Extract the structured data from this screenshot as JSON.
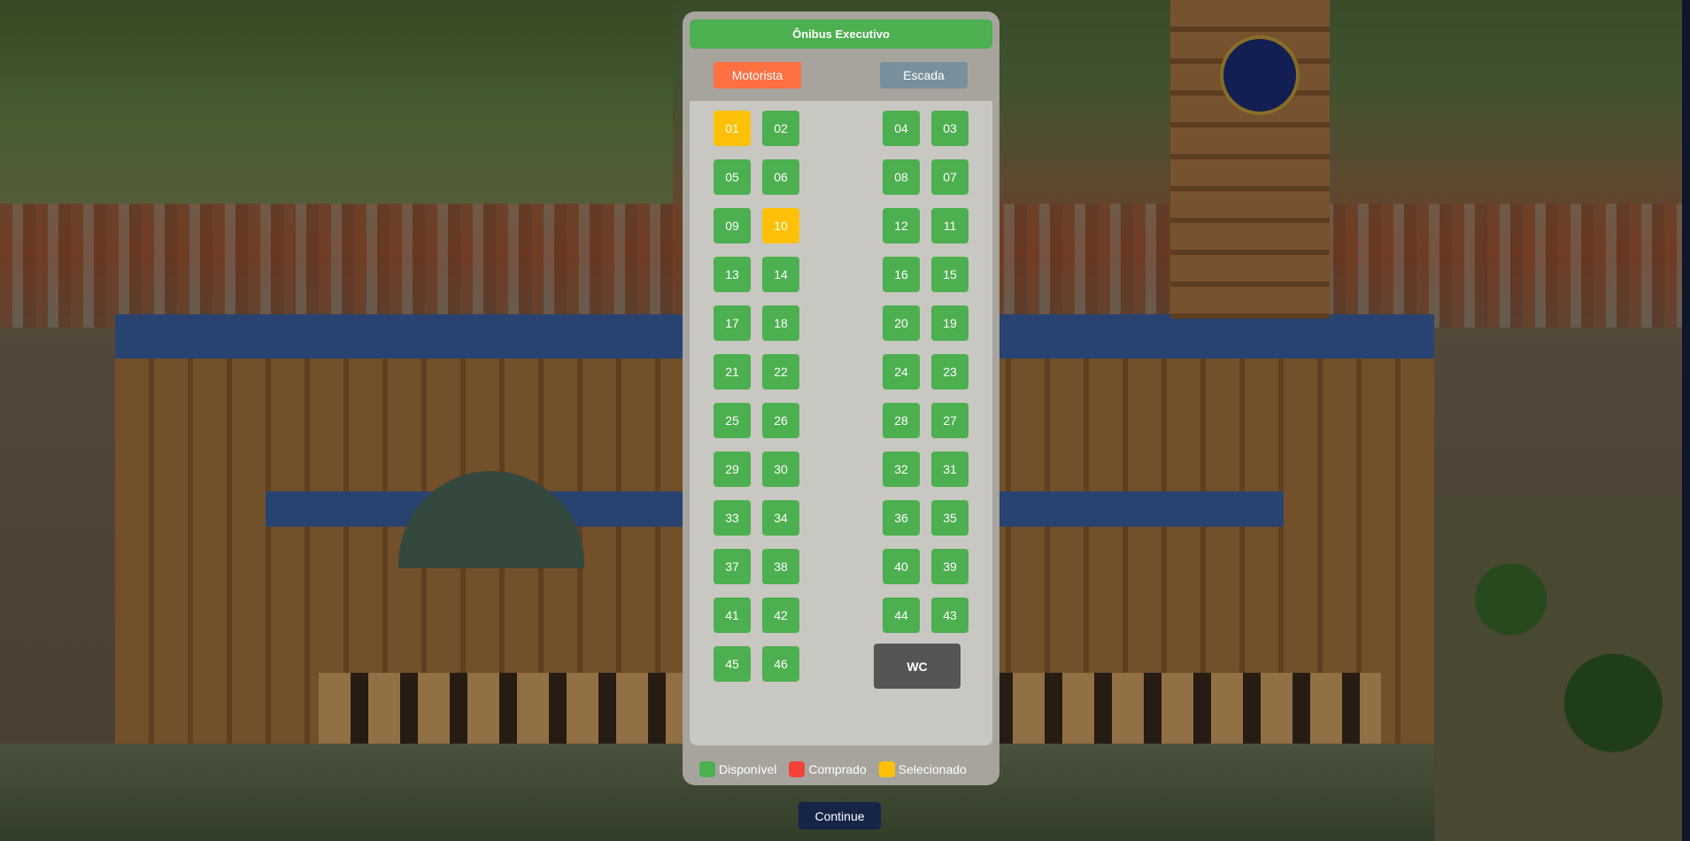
{
  "bus": {
    "title": "Ônibus Executivo",
    "driver_label": "Motorista",
    "stairs_label": "Escada",
    "wc_label": "WC"
  },
  "seats": [
    {
      "number": "01",
      "status": "selected"
    },
    {
      "number": "02",
      "status": "available"
    },
    {
      "number": "04",
      "status": "available"
    },
    {
      "number": "03",
      "status": "available"
    },
    {
      "number": "05",
      "status": "available"
    },
    {
      "number": "06",
      "status": "available"
    },
    {
      "number": "08",
      "status": "available"
    },
    {
      "number": "07",
      "status": "available"
    },
    {
      "number": "09",
      "status": "available"
    },
    {
      "number": "10",
      "status": "selected"
    },
    {
      "number": "12",
      "status": "available"
    },
    {
      "number": "11",
      "status": "available"
    },
    {
      "number": "13",
      "status": "available"
    },
    {
      "number": "14",
      "status": "available"
    },
    {
      "number": "16",
      "status": "available"
    },
    {
      "number": "15",
      "status": "available"
    },
    {
      "number": "17",
      "status": "available"
    },
    {
      "number": "18",
      "status": "available"
    },
    {
      "number": "20",
      "status": "available"
    },
    {
      "number": "19",
      "status": "available"
    },
    {
      "number": "21",
      "status": "available"
    },
    {
      "number": "22",
      "status": "available"
    },
    {
      "number": "24",
      "status": "available"
    },
    {
      "number": "23",
      "status": "available"
    },
    {
      "number": "25",
      "status": "available"
    },
    {
      "number": "26",
      "status": "available"
    },
    {
      "number": "28",
      "status": "available"
    },
    {
      "number": "27",
      "status": "available"
    },
    {
      "number": "29",
      "status": "available"
    },
    {
      "number": "30",
      "status": "available"
    },
    {
      "number": "32",
      "status": "available"
    },
    {
      "number": "31",
      "status": "available"
    },
    {
      "number": "33",
      "status": "available"
    },
    {
      "number": "34",
      "status": "available"
    },
    {
      "number": "36",
      "status": "available"
    },
    {
      "number": "35",
      "status": "available"
    },
    {
      "number": "37",
      "status": "available"
    },
    {
      "number": "38",
      "status": "available"
    },
    {
      "number": "40",
      "status": "available"
    },
    {
      "number": "39",
      "status": "available"
    },
    {
      "number": "41",
      "status": "available"
    },
    {
      "number": "42",
      "status": "available"
    },
    {
      "number": "44",
      "status": "available"
    },
    {
      "number": "43",
      "status": "available"
    },
    {
      "number": "45",
      "status": "available"
    },
    {
      "number": "46",
      "status": "available"
    }
  ],
  "legend": {
    "available": {
      "label": "Disponível",
      "color": "#4caf50"
    },
    "purchased": {
      "label": "Comprado",
      "color": "#f44336"
    },
    "selected": {
      "label": "Selecionado",
      "color": "#ffc107"
    }
  },
  "continue_label": "Continue"
}
